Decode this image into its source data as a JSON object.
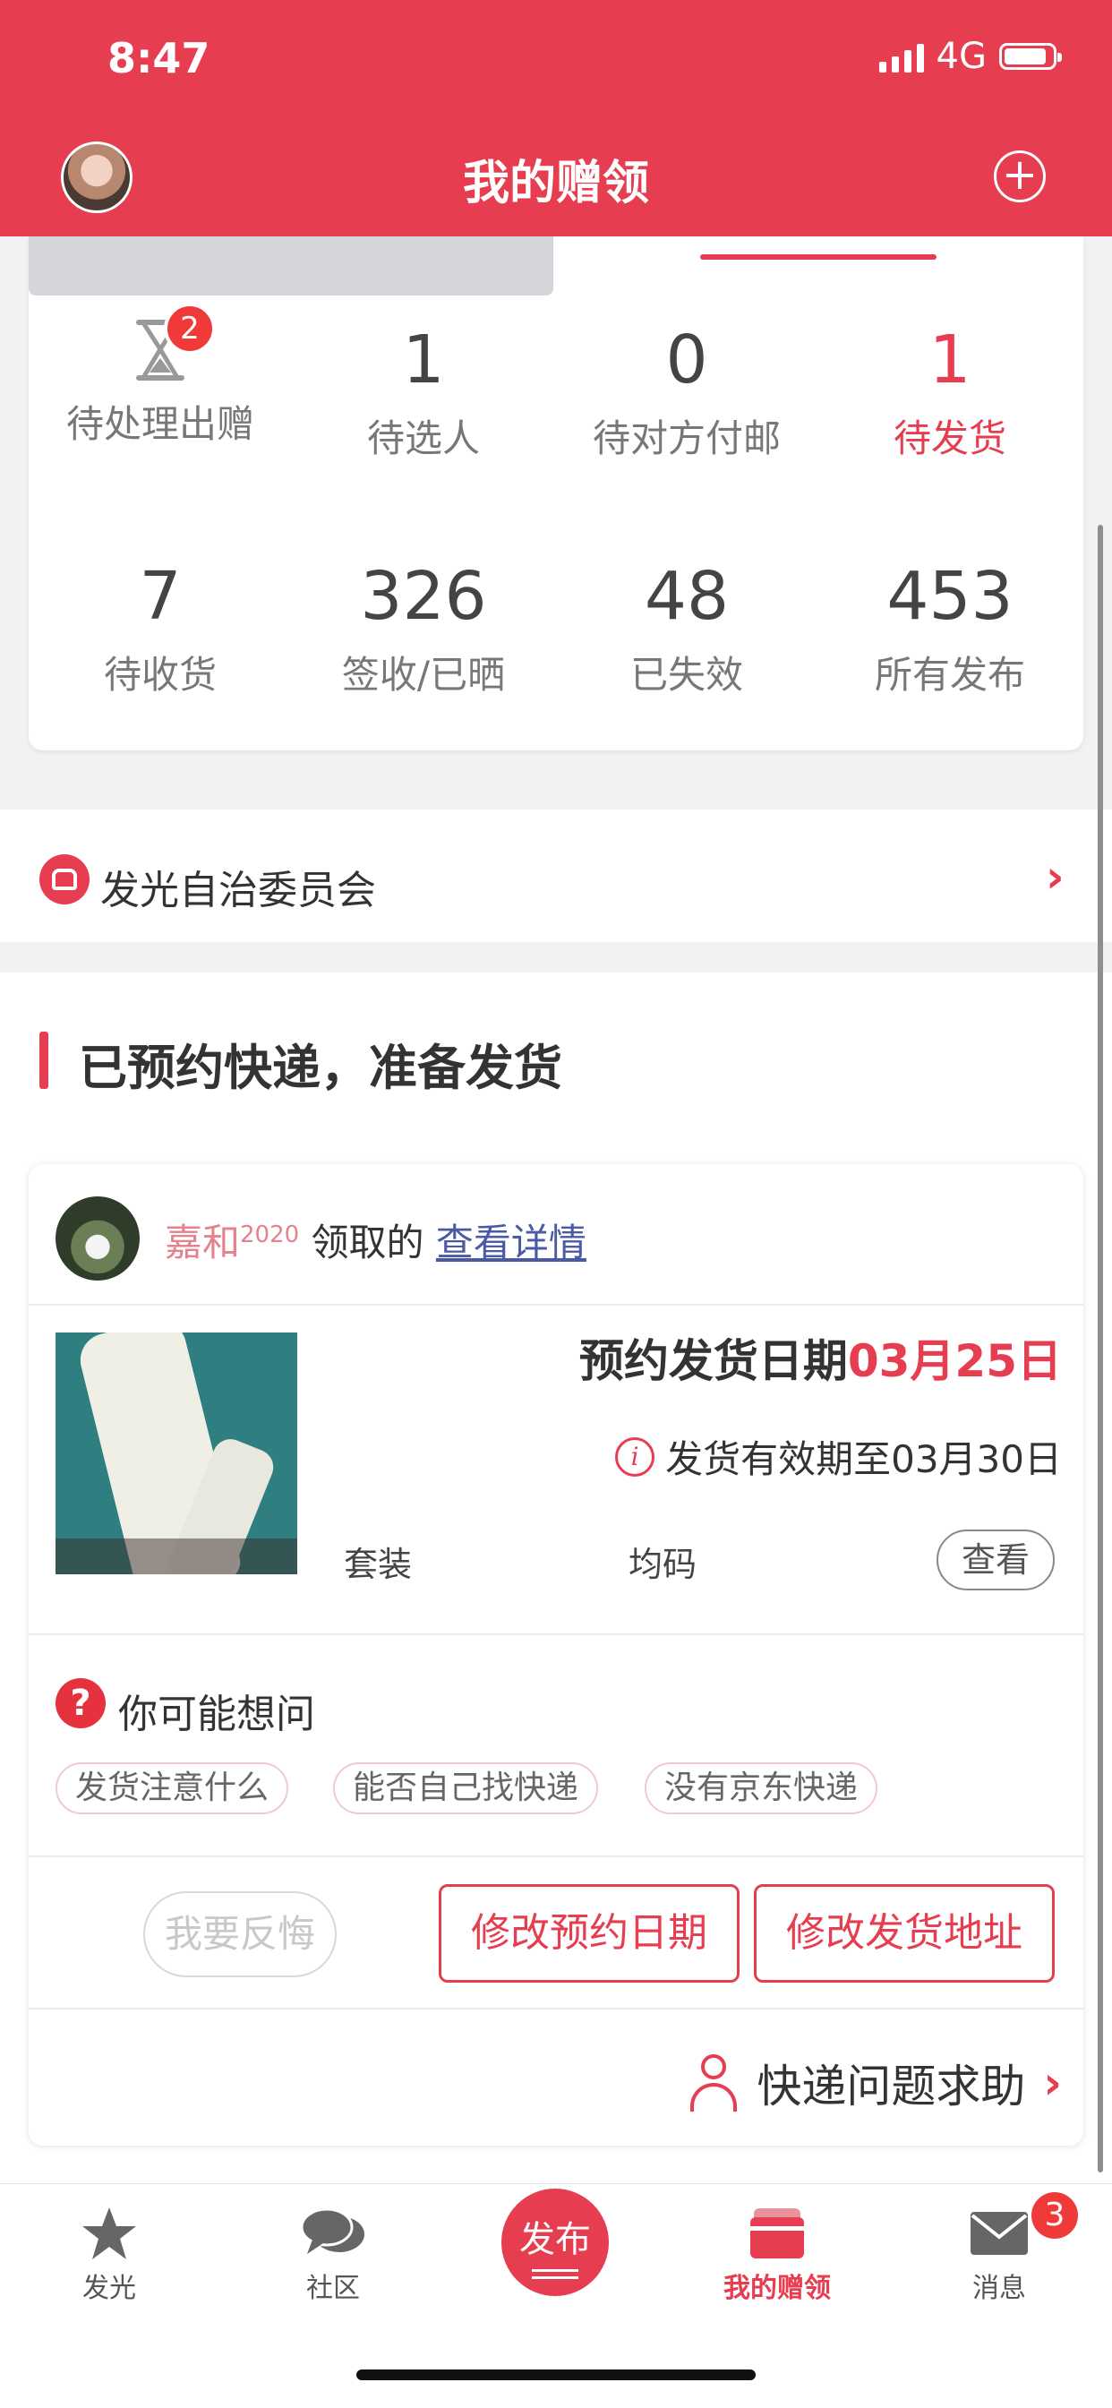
{
  "status": {
    "time": "8:47",
    "network": "4G"
  },
  "header": {
    "title": "我的赠领",
    "add_icon": "plus-circle-icon"
  },
  "stats_row1": [
    {
      "value": "",
      "label": "待处理出赠",
      "badge": "2",
      "icon": "hourglass-icon"
    },
    {
      "value": "1",
      "label": "待选人"
    },
    {
      "value": "0",
      "label": "待对方付邮"
    },
    {
      "value": "1",
      "label": "待发货",
      "active": true
    }
  ],
  "stats_row2": [
    {
      "value": "7",
      "label": "待收货"
    },
    {
      "value": "326",
      "label": "签收/已晒"
    },
    {
      "value": "48",
      "label": "已失效"
    },
    {
      "value": "453",
      "label": "所有发布"
    }
  ],
  "committee": {
    "label": "发光自治委员会"
  },
  "section": {
    "title": "已预约快递，准备发货"
  },
  "order": {
    "user_name": "嘉和",
    "user_name_sup": "2020",
    "received_text": "领取的",
    "view_details": "查看详情",
    "ship_date_label": "预约发货日期",
    "ship_date_value": "03月25日",
    "valid_text": "发货有效期至03月30日",
    "tag_type": "套装",
    "tag_size": "均码",
    "view_button": "查看"
  },
  "faq": {
    "title": "你可能想问",
    "chips": [
      "发货注意什么",
      "能否自己找快递",
      "没有京东快递"
    ]
  },
  "actions": {
    "regret": "我要反悔",
    "change_date": "修改预约日期",
    "change_address": "修改发货地址"
  },
  "help": {
    "label": "快递问题求助"
  },
  "tabbar": {
    "items": [
      {
        "label": "发光",
        "icon": "star-icon"
      },
      {
        "label": "社区",
        "icon": "chat-bubbles-icon"
      },
      {
        "label": "发布",
        "icon": "publish-icon"
      },
      {
        "label": "我的赠领",
        "icon": "gift-card-icon",
        "active": true
      },
      {
        "label": "消息",
        "icon": "mail-icon",
        "badge": "3"
      }
    ]
  },
  "colors": {
    "accent": "#e63d50",
    "link": "#4a5aa3"
  }
}
